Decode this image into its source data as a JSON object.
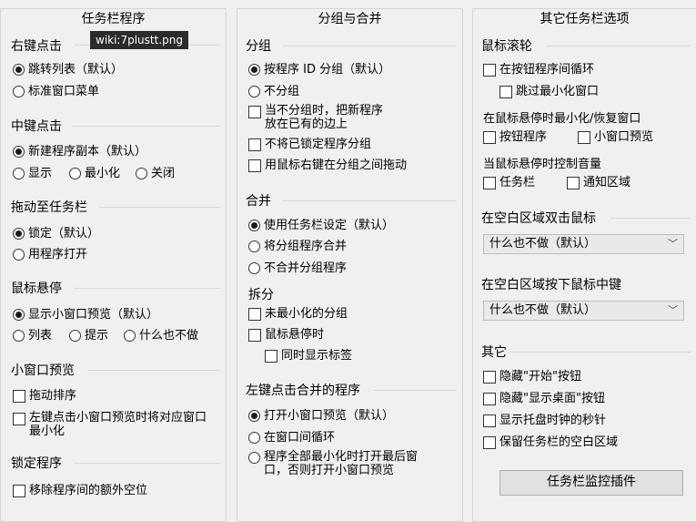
{
  "tooltip": "wiki:7plustt.png",
  "col1": {
    "title": "任务栏程序",
    "right_click": {
      "title": "右键点击",
      "opt_jumplist": "跳转列表（默认）",
      "opt_window_menu": "标准窗口菜单"
    },
    "middle_click": {
      "title": "中键点击",
      "opt_new_instance": "新建程序副本（默认）",
      "opt_show": "显示",
      "opt_minimize": "最小化",
      "opt_close": "关闭"
    },
    "drag": {
      "title": "拖动至任务栏",
      "opt_pin": "锁定（默认）",
      "opt_open_with": "用程序打开"
    },
    "hover": {
      "title": "鼠标悬停",
      "opt_thumbnail": "显示小窗口预览（默认）",
      "opt_list": "列表",
      "opt_tooltip": "提示",
      "opt_nothing": "什么也不做"
    },
    "thumbnail": {
      "title": "小窗口预览",
      "opt_drag_reorder": "拖动排序",
      "opt_left_click_minimize": "左键点击小窗口预览时将对应窗口最小化"
    },
    "pinned": {
      "title": "锁定程序",
      "opt_remove_gap": "移除程序间的额外空位"
    }
  },
  "col2": {
    "title": "分组与合并",
    "grouping": {
      "title": "分组",
      "opt_by_id": "按程序 ID 分组（默认）",
      "opt_no_group": "不分组",
      "opt_place_new": "当不分组时，把新程序放在已有的边上",
      "opt_no_pinned": "不将已锁定程序分组",
      "opt_right_drag": "用鼠标右键在分组之间拖动"
    },
    "combine": {
      "title": "合并",
      "opt_use_setting": "使用任务栏设定（默认）",
      "opt_combine": "将分组程序合并",
      "opt_no_combine": "不合并分组程序"
    },
    "split": {
      "title": "拆分",
      "opt_non_minimized": "未最小化的分组",
      "opt_on_hover": "鼠标悬停时",
      "opt_show_labels": "同时显示标签"
    },
    "left_click": {
      "title": "左键点击合并的程序",
      "opt_open_thumbnail": "打开小窗口预览（默认）",
      "opt_cycle": "在窗口间循环",
      "opt_open_last": "程序全部最小化时打开最后窗口，否则打开小窗口预览"
    }
  },
  "col3": {
    "title": "其它任务栏选项",
    "wheel": {
      "title": "鼠标滚轮",
      "opt_cycle_buttons": "在按钮程序间循环",
      "opt_skip_minimized": "跳过最小化窗口",
      "minimize_restore_title": "在鼠标悬停时最小化/恢复窗口",
      "opt_buttons": "按钮程序",
      "opt_thumb_preview": "小窗口预览",
      "volume_title": "当鼠标悬停时控制音量",
      "opt_taskbar": "任务栏",
      "opt_notify_area": "通知区域"
    },
    "dbl_click": {
      "title": "在空白区域双击鼠标",
      "value": "什么也不做（默认）"
    },
    "mid_click": {
      "title": "在空白区域按下鼠标中键",
      "value": "什么也不做（默认）"
    },
    "other": {
      "title": "其它",
      "opt_hide_start": "隐藏\"开始\"按钮",
      "opt_hide_desktop": "隐藏\"显示桌面\"按钮",
      "opt_clock_seconds": "显示托盘时钟的秒针",
      "opt_keep_space": "保留任务栏的空白区域"
    },
    "plugin_button": "任务栏监控插件"
  }
}
